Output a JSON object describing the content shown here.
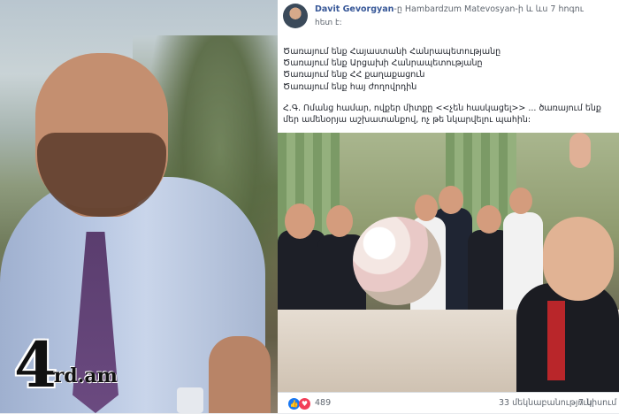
{
  "logo": {
    "number": "4",
    "text": "rd.am"
  },
  "post": {
    "author": "Davit Gevorgyan",
    "action": "-ը Hambardzum Matevosyan-ի և ևս 7 հոգու",
    "sub": "հետ է:",
    "lines": [
      "Ծառայում ենք Հայաստանի Հանրապետությանը",
      "Ծառայում ենք Արցախի Հանրապետությանը",
      "Ծառայում ենք ՀՀ քաղաքացուն",
      "Ծառայում ենք հայ ժողովրդին"
    ],
    "ps_line1": "Հ.Գ. Ոմանց համար, ովքեր միտքը <<չեն հասկացել>> ... ծառայում ենք",
    "ps_line2": "մեր ամենօրյա աշխատանքով, ոչ թե նկարվելու պահին:"
  },
  "footer": {
    "reactions_count": "489",
    "comments": "33 մեկնաբանություն",
    "shares": "7 կիսում"
  },
  "colors": {
    "link": "#385898",
    "like": "#1877f2",
    "love": "#f33e58"
  }
}
